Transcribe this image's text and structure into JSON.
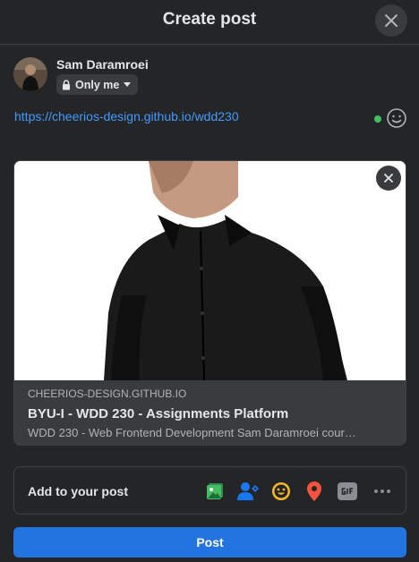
{
  "header": {
    "title": "Create post"
  },
  "author": {
    "name": "Sam Daramroei",
    "privacy": "Only me"
  },
  "composer": {
    "text": "https://cheerios-design.github.io/wdd230"
  },
  "link_preview": {
    "domain": "CHEERIOS-DESIGN.GITHUB.IO",
    "title": "BYU-I - WDD 230 - Assignments Platform",
    "description": "WDD 230 - Web Frontend Development Sam Daramroei cour…"
  },
  "add_to_post": {
    "label": "Add to your post",
    "tools": [
      "photo-video-icon",
      "tag-people-icon",
      "feeling-icon",
      "check-in-icon",
      "gif-icon",
      "more-icon"
    ]
  },
  "post_button": {
    "label": "Post"
  },
  "colors": {
    "accent": "#2374e1",
    "link": "#4599ff",
    "background": "#242526",
    "surface": "#3a3b3c"
  }
}
